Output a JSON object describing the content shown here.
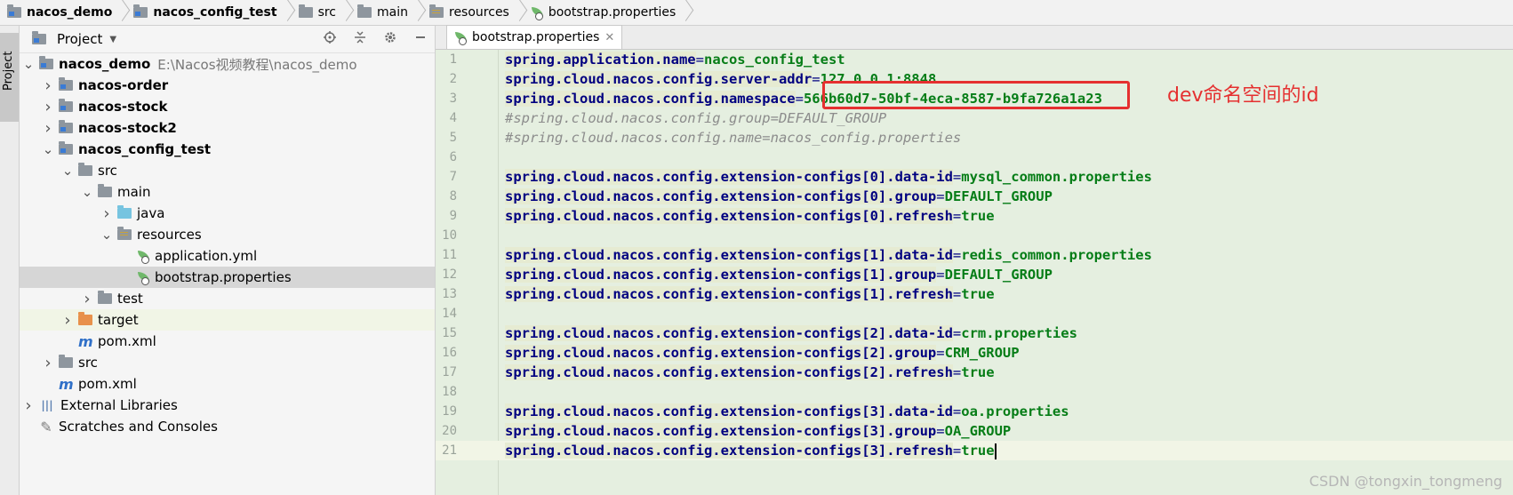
{
  "breadcrumb": [
    {
      "label": "nacos_demo",
      "icon": "module-folder-icon",
      "bold": true
    },
    {
      "label": "nacos_config_test",
      "icon": "module-folder-icon",
      "bold": true
    },
    {
      "label": "src",
      "icon": "folder-icon",
      "bold": false
    },
    {
      "label": "main",
      "icon": "folder-icon",
      "bold": false
    },
    {
      "label": "resources",
      "icon": "resources-folder-icon",
      "bold": false
    },
    {
      "label": "bootstrap.properties",
      "icon": "spring-properties-icon",
      "bold": false
    }
  ],
  "side_tab": {
    "label": "Project"
  },
  "project_panel": {
    "title": "Project",
    "tree": [
      {
        "label": "nacos_demo",
        "path": "E:\\Nacos视频教程\\nacos_demo",
        "depth": 0,
        "arrow": "down",
        "icon": "module-folder-icon",
        "bold": true
      },
      {
        "label": "nacos-order",
        "depth": 1,
        "arrow": "right",
        "icon": "module-folder-icon",
        "bold": true
      },
      {
        "label": "nacos-stock",
        "depth": 1,
        "arrow": "right",
        "icon": "module-folder-icon",
        "bold": true
      },
      {
        "label": "nacos-stock2",
        "depth": 1,
        "arrow": "right",
        "icon": "module-folder-icon",
        "bold": true
      },
      {
        "label": "nacos_config_test",
        "depth": 1,
        "arrow": "down",
        "icon": "module-folder-icon",
        "bold": true
      },
      {
        "label": "src",
        "depth": 2,
        "arrow": "down",
        "icon": "folder-icon",
        "bold": false
      },
      {
        "label": "main",
        "depth": 3,
        "arrow": "down",
        "icon": "folder-icon",
        "bold": false
      },
      {
        "label": "java",
        "depth": 4,
        "arrow": "right",
        "icon": "java-folder-icon",
        "bold": false
      },
      {
        "label": "resources",
        "depth": 4,
        "arrow": "down",
        "icon": "resources-folder-icon",
        "bold": false
      },
      {
        "label": "application.yml",
        "depth": 5,
        "arrow": "",
        "icon": "spring-yml-icon",
        "bold": false
      },
      {
        "label": "bootstrap.properties",
        "depth": 5,
        "arrow": "",
        "icon": "spring-properties-icon",
        "bold": false,
        "selected": true
      },
      {
        "label": "test",
        "depth": 3,
        "arrow": "right",
        "icon": "folder-icon",
        "bold": false
      },
      {
        "label": "target",
        "depth": 2,
        "arrow": "right",
        "icon": "target-folder-icon",
        "bold": false,
        "tinted": true
      },
      {
        "label": "pom.xml",
        "depth": 2,
        "arrow": "",
        "icon": "maven-icon",
        "bold": false
      },
      {
        "label": "src",
        "depth": 1,
        "arrow": "right",
        "icon": "folder-icon",
        "bold": false
      },
      {
        "label": "pom.xml",
        "depth": 1,
        "arrow": "",
        "icon": "maven-icon",
        "bold": false
      },
      {
        "label": "External Libraries",
        "depth": 0,
        "arrow": "right",
        "icon": "libraries-icon",
        "bold": false
      },
      {
        "label": "Scratches and Consoles",
        "depth": 0,
        "arrow": "",
        "icon": "scratches-icon",
        "bold": false
      }
    ]
  },
  "editor": {
    "tab_label": "bootstrap.properties",
    "lines": [
      {
        "n": "1",
        "type": "kv",
        "key": "spring.application.name",
        "value": "nacos_config_test"
      },
      {
        "n": "2",
        "type": "kv",
        "key": "spring.cloud.nacos.config.server-addr",
        "value": "127.0.0.1:8848"
      },
      {
        "n": "3",
        "type": "kv",
        "key": "spring.cloud.nacos.config.namespace",
        "value": "566b60d7-50bf-4eca-8587-b9fa726a1a23"
      },
      {
        "n": "4",
        "type": "comment",
        "text": "#spring.cloud.nacos.config.group=DEFAULT_GROUP"
      },
      {
        "n": "5",
        "type": "comment",
        "text": "#spring.cloud.nacos.config.name=nacos_config.properties"
      },
      {
        "n": "6",
        "type": "blank"
      },
      {
        "n": "7",
        "type": "kv",
        "key": "spring.cloud.nacos.config.extension-configs[0].data-id",
        "value": "mysql_common.properties"
      },
      {
        "n": "8",
        "type": "kv",
        "key": "spring.cloud.nacos.config.extension-configs[0].group",
        "value": "DEFAULT_GROUP"
      },
      {
        "n": "9",
        "type": "kv",
        "key": "spring.cloud.nacos.config.extension-configs[0].refresh",
        "value": "true"
      },
      {
        "n": "10",
        "type": "blank"
      },
      {
        "n": "11",
        "type": "kv",
        "key": "spring.cloud.nacos.config.extension-configs[1].data-id",
        "value": "redis_common.properties"
      },
      {
        "n": "12",
        "type": "kv",
        "key": "spring.cloud.nacos.config.extension-configs[1].group",
        "value": "DEFAULT_GROUP"
      },
      {
        "n": "13",
        "type": "kv",
        "key": "spring.cloud.nacos.config.extension-configs[1].refresh",
        "value": "true"
      },
      {
        "n": "14",
        "type": "blank"
      },
      {
        "n": "15",
        "type": "kv",
        "key": "spring.cloud.nacos.config.extension-configs[2].data-id",
        "value": "crm.properties"
      },
      {
        "n": "16",
        "type": "kv",
        "key": "spring.cloud.nacos.config.extension-configs[2].group",
        "value": "CRM_GROUP"
      },
      {
        "n": "17",
        "type": "kv",
        "key": "spring.cloud.nacos.config.extension-configs[2].refresh",
        "value": "true"
      },
      {
        "n": "18",
        "type": "blank"
      },
      {
        "n": "19",
        "type": "kv",
        "key": "spring.cloud.nacos.config.extension-configs[3].data-id",
        "value": "oa.properties"
      },
      {
        "n": "20",
        "type": "kv",
        "key": "spring.cloud.nacos.config.extension-configs[3].group",
        "value": "OA_GROUP"
      },
      {
        "n": "21",
        "type": "kv",
        "key": "spring.cloud.nacos.config.extension-configs[3].refresh",
        "value": "true",
        "current": true
      }
    ]
  },
  "annotation": {
    "text": "dev命名空间的id",
    "color": "#e53030"
  },
  "watermark": "CSDN @tongxin_tongmeng"
}
